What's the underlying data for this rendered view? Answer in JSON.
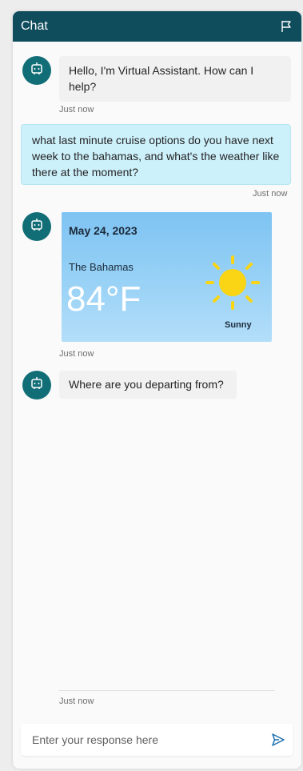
{
  "header": {
    "title": "Chat",
    "flag_icon": "flag-icon"
  },
  "messages": {
    "greeting": {
      "text": "Hello, I'm Virtual Assistant. How can I help?",
      "time": "Just now"
    },
    "user_query": {
      "text": "what last minute cruise options do you have next week to the bahamas, and what's the weather like there at the moment?",
      "time": "Just now"
    },
    "weather_card": {
      "date": "May 24, 2023",
      "location": "The Bahamas",
      "temperature": "84°F",
      "condition": "Sunny",
      "time": "Just now",
      "colors": {
        "sun": "#f9d515",
        "card_top": "#7ec3f2",
        "card_bottom": "#b3def9"
      }
    },
    "departure_question": {
      "text": "Where are you departing from?"
    },
    "last_time": "Just now"
  },
  "composer": {
    "placeholder": "Enter your response here",
    "send_icon": "send-icon"
  },
  "colors": {
    "header": "#0f4c5c",
    "avatar": "#126e76",
    "user_bubble": "#cdf1fb"
  }
}
